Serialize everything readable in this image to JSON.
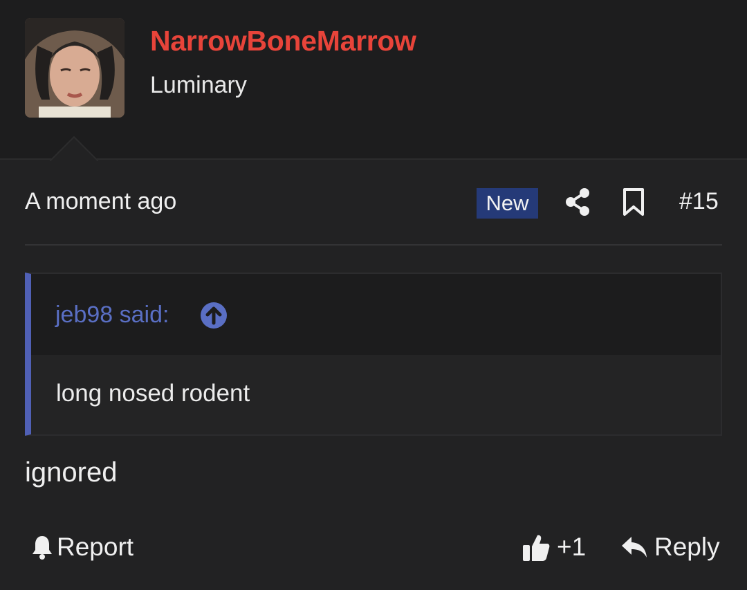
{
  "post": {
    "author": {
      "username": "NarrowBoneMarrow",
      "title": "Luminary",
      "username_color": "#e8443a"
    },
    "timestamp": "A moment ago",
    "badge": "New",
    "post_number": "#15",
    "quote": {
      "author_label": "jeb98 said:",
      "text": "long nosed rodent"
    },
    "message": "ignored",
    "actions": {
      "report_label": "Report",
      "like_count": "+1",
      "reply_label": "Reply"
    }
  },
  "icons": {
    "share": "share-icon",
    "bookmark": "bookmark-icon",
    "jump": "arrow-circle-up-icon",
    "report": "bell-icon",
    "like": "thumbs-up-icon",
    "reply": "reply-arrow-icon"
  },
  "colors": {
    "background": "#222223",
    "header_background": "#1d1d1e",
    "accent_blue": "#5060b5",
    "badge_blue": "#253a78"
  }
}
